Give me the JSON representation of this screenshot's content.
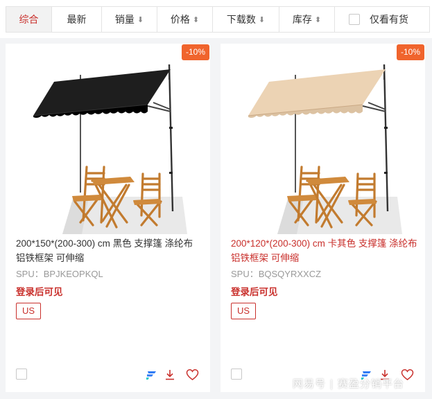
{
  "sortbar": {
    "tabs": [
      {
        "label": "综合",
        "arrow": ""
      },
      {
        "label": "最新",
        "arrow": ""
      },
      {
        "label": "销量",
        "arrow": "⬇"
      },
      {
        "label": "价格",
        "arrow": "⬍"
      },
      {
        "label": "下载数",
        "arrow": "⬇"
      },
      {
        "label": "库存",
        "arrow": "⬍"
      }
    ],
    "stock_only_label": "仅看有货"
  },
  "products": [
    {
      "discount": "-10%",
      "title": "200*150*(200-300) cm 黑色 支撑篷 涤纶布 铝铁框架 可伸缩",
      "spu": "SPU：BPJKEOPKQL",
      "price_note": "登录后可见",
      "region": "US",
      "fabric_color": "#1e1e1e",
      "icons": [
        "brand-logo-icon",
        "download-icon",
        "heart-icon"
      ]
    },
    {
      "discount": "-10%",
      "title": "200*120*(200-300) cm 卡其色 支撑篷 涤纶布 铝铁框架 可伸缩",
      "spu": "SPU：BQSQYRXXCZ",
      "price_note": "登录后可见",
      "region": "US",
      "fabric_color": "#ecd3b4",
      "icons": [
        "brand-logo-icon",
        "download-icon",
        "heart-icon"
      ]
    }
  ],
  "watermark": {
    "left": "网易号",
    "sep": "|",
    "right": "赛盈分销平台"
  },
  "colors": {
    "accent": "#c9302c",
    "badge": "#f0642d",
    "brand_blue": "#2f7bf5"
  }
}
